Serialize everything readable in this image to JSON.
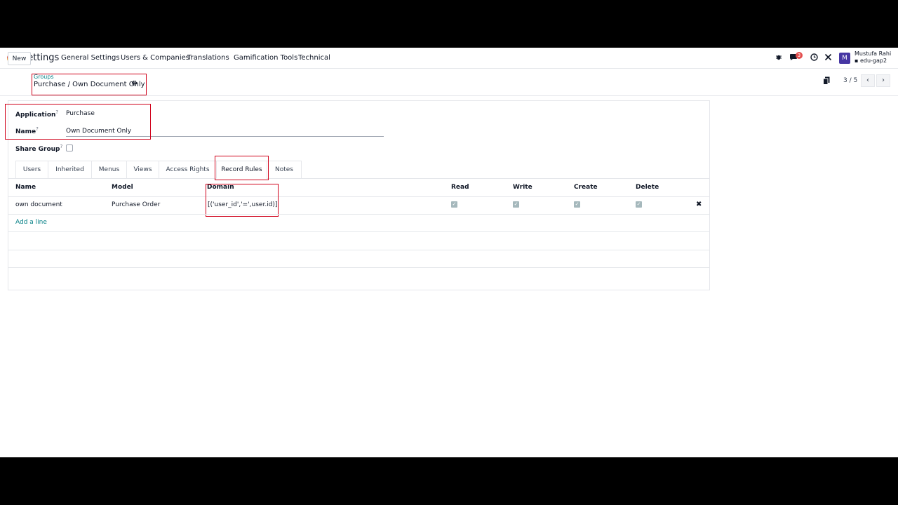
{
  "navbar": {
    "app_title": "Settings",
    "menus": [
      "General Settings",
      "Users & Companies",
      "Translations",
      "Gamification Tools",
      "Technical"
    ],
    "chat_badge": "3",
    "avatar_letter": "M",
    "user_name": "Mustufa Rahi",
    "database": "edu-gap2",
    "icons": [
      "bug-icon",
      "chat-icon",
      "clock-icon",
      "tools-icon"
    ]
  },
  "control": {
    "new_label": "New",
    "breadcrumb_parent": "Groups",
    "breadcrumb_current": "Purchase / Own Document Only",
    "pager": "3 / 5"
  },
  "form": {
    "application_label": "Application",
    "application_value": "Purchase",
    "name_label": "Name",
    "name_value": "Own Document Only",
    "share_group_label": "Share Group",
    "share_group_checked": false,
    "help_mark": "?"
  },
  "tabs": [
    "Users",
    "Inherited",
    "Menus",
    "Views",
    "Access Rights",
    "Record Rules",
    "Notes"
  ],
  "active_tab": "Record Rules",
  "table": {
    "columns": [
      "Name",
      "Model",
      "Domain",
      "Read",
      "Write",
      "Create",
      "Delete"
    ],
    "rows": [
      {
        "name": "own document",
        "model": "Purchase Order",
        "domain": "[('user_id','=',user.id)]",
        "read": true,
        "write": true,
        "create": true,
        "delete": true
      }
    ],
    "add_line": "Add a line"
  },
  "colors": {
    "accent": "#017e84",
    "highlight": "#d0021b",
    "badge": "#e34f4f",
    "avatar": "#4636a3"
  }
}
